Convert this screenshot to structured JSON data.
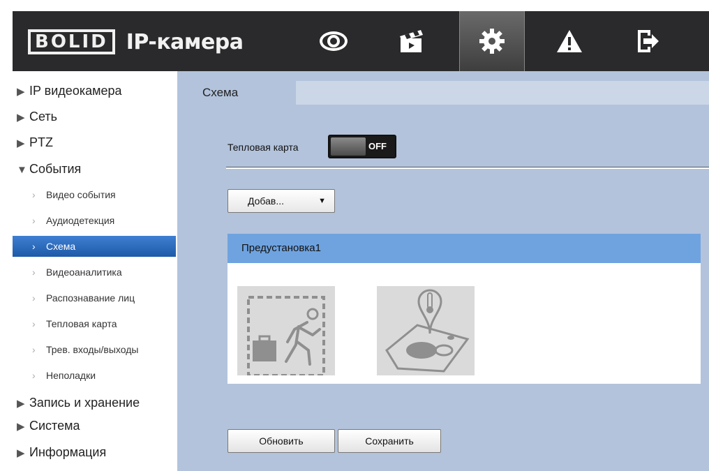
{
  "header": {
    "brand": "BOLID",
    "title": "IP-камера",
    "nav": [
      {
        "icon": "eye-icon"
      },
      {
        "icon": "clapperboard-icon"
      },
      {
        "icon": "gear-icon",
        "active": true
      },
      {
        "icon": "warning-icon"
      },
      {
        "icon": "logout-icon"
      }
    ]
  },
  "sidebar": {
    "items": [
      {
        "label": "IP видеокамера"
      },
      {
        "label": "Сеть"
      },
      {
        "label": "PTZ"
      },
      {
        "label": "События",
        "expanded": true
      },
      {
        "label": "Видео события"
      },
      {
        "label": "Аудиодетекция"
      },
      {
        "label": "Схема",
        "active": true
      },
      {
        "label": "Видеоаналитика"
      },
      {
        "label": "Распознавание лиц"
      },
      {
        "label": "Тепловая карта"
      },
      {
        "label": "Трев. входы/выходы"
      },
      {
        "label": "Неполадки"
      },
      {
        "label": "Запись и хранение"
      },
      {
        "label": "Система"
      },
      {
        "label": "Информация"
      }
    ]
  },
  "main": {
    "tab": "Схема",
    "heatmap_label": "Тепловая карта",
    "toggle_state": "OFF",
    "dropdown_value": "Добав...",
    "panel_title": "Предустановка1",
    "tiles": [
      {
        "icon": "abandoned-object-icon"
      },
      {
        "icon": "heat-map-icon"
      }
    ],
    "buttons": {
      "refresh": "Обновить",
      "save": "Сохранить"
    }
  },
  "colors": {
    "header_bg": "#2a2a2c",
    "content_bg": "#b3c3dc",
    "panel_head": "#6fa3e0",
    "active_item": "#2867bb"
  }
}
